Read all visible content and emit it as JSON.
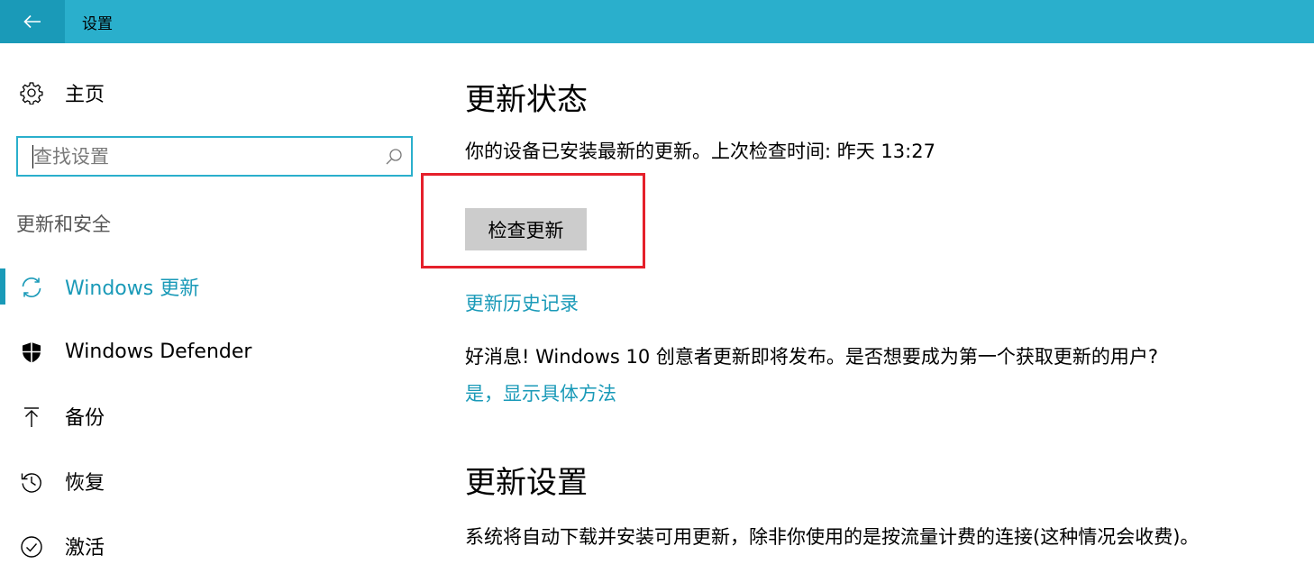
{
  "theme": {
    "accent": "#2aafcc",
    "accent_dark": "#1a9ab8",
    "highlight": "#e5202b"
  },
  "titlebar": {
    "title": "设置",
    "back_icon": "back-arrow-icon"
  },
  "sidebar": {
    "home_label": "主页",
    "home_icon": "gear-icon",
    "search_placeholder": "查找设置",
    "search_icon": "search-icon",
    "section_heading": "更新和安全",
    "items": [
      {
        "label": "Windows 更新",
        "icon": "sync-icon",
        "active": true
      },
      {
        "label": "Windows Defender",
        "icon": "shield-icon",
        "active": false
      },
      {
        "label": "备份",
        "icon": "upload-arrow-icon",
        "active": false
      },
      {
        "label": "恢复",
        "icon": "history-icon",
        "active": false
      },
      {
        "label": "激活",
        "icon": "check-circle-icon",
        "active": false
      }
    ]
  },
  "main": {
    "status_heading": "更新状态",
    "status_text": "你的设备已安装最新的更新。上次检查时间: 昨天 13:27",
    "check_button": "检查更新",
    "history_link": "更新历史记录",
    "news_text": "好消息! Windows 10 创意者更新即将发布。是否想要成为第一个获取更新的用户?",
    "news_link": "是，显示具体方法",
    "settings_heading": "更新设置",
    "settings_text": "系统将自动下载并安装可用更新，除非你使用的是按流量计费的连接(这种情况会收费)。"
  }
}
